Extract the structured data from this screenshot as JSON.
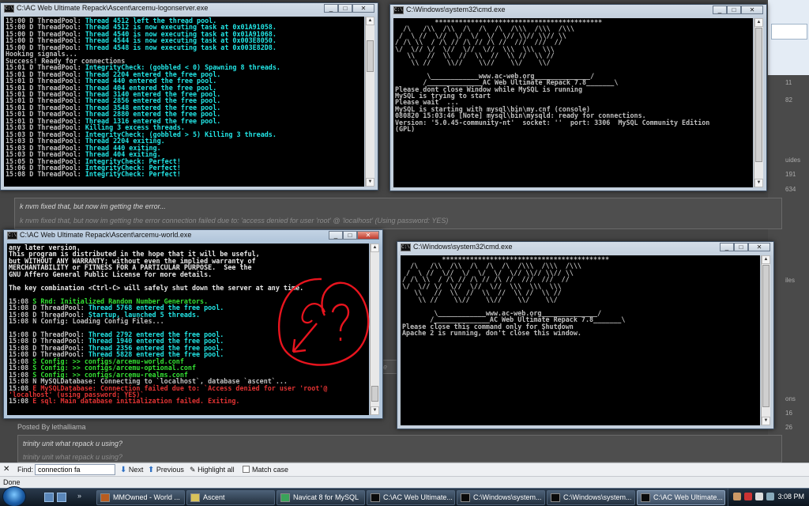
{
  "forum": {
    "right_numbers": [
      "11",
      "82",
      "uides",
      "191",
      "634",
      "iles",
      "ons",
      "16",
      "26"
    ],
    "post1_line1": "k nvm fixed that, but now im getting the error...",
    "post1_line2": "k nvm fixed that, but now im getting the error connection failed due to: 'access denied for user 'root' @ 'localhost' (Using password: YES)",
    "posted_by": "Posted By lethalliama",
    "post2_line1": "trinity unit what repack u using?",
    "post2_line2": "trinity unit what repack u using?",
    "fragment_e": "e"
  },
  "windows": {
    "logon": {
      "title": "C:\\AC Web Ultimate Repack\\Ascent\\arcemu-logonserver.exe",
      "lines": [
        [
          [
            "c-grey",
            "15:00 D ThreadPool: "
          ],
          [
            "c-cyan",
            "Thread 4512 left the thread pool."
          ]
        ],
        [
          [
            "c-grey",
            "15:00 D ThreadPool: "
          ],
          [
            "c-cyan",
            "Thread 4512 is now executing task at 0x01A91058."
          ]
        ],
        [
          [
            "c-grey",
            "15:00 D ThreadPool: "
          ],
          [
            "c-cyan",
            "Thread 4540 is now executing task at 0x01A91068."
          ]
        ],
        [
          [
            "c-grey",
            "15:00 D ThreadPool: "
          ],
          [
            "c-cyan",
            "Thread 4544 is now executing task at 0x003E8050."
          ]
        ],
        [
          [
            "c-grey",
            "15:00 D ThreadPool: "
          ],
          [
            "c-cyan",
            "Thread 4548 is now executing task at 0x003E82D8."
          ]
        ],
        [
          [
            "c-grey",
            "Hooking signals..."
          ]
        ],
        [
          [
            "c-grey",
            "Success! Ready for connections"
          ]
        ],
        [
          [
            "c-grey",
            "15:01 D ThreadPool: "
          ],
          [
            "c-cyan",
            "IntegrityCheck: (gobbled < 0) Spawning 8 threads."
          ]
        ],
        [
          [
            "c-grey",
            "15:01 D ThreadPool: "
          ],
          [
            "c-cyan",
            "Thread 2204 entered the free pool."
          ]
        ],
        [
          [
            "c-grey",
            "15:01 D ThreadPool: "
          ],
          [
            "c-cyan",
            "Thread 440 entered the free pool."
          ]
        ],
        [
          [
            "c-grey",
            "15:01 D ThreadPool: "
          ],
          [
            "c-cyan",
            "Thread 404 entered the free pool."
          ]
        ],
        [
          [
            "c-grey",
            "15:01 D ThreadPool: "
          ],
          [
            "c-cyan",
            "Thread 3140 entered the free pool."
          ]
        ],
        [
          [
            "c-grey",
            "15:01 D ThreadPool: "
          ],
          [
            "c-cyan",
            "Thread 2856 entered the free pool."
          ]
        ],
        [
          [
            "c-grey",
            "15:01 D ThreadPool: "
          ],
          [
            "c-cyan",
            "Thread 3548 entered the free pool."
          ]
        ],
        [
          [
            "c-grey",
            "15:01 D ThreadPool: "
          ],
          [
            "c-cyan",
            "Thread 2880 entered the free pool."
          ]
        ],
        [
          [
            "c-grey",
            "15:01 D ThreadPool: "
          ],
          [
            "c-cyan",
            "Thread 1316 entered the free pool."
          ]
        ],
        [
          [
            "c-grey",
            "15:03 D ThreadPool: "
          ],
          [
            "c-cyan",
            "Killing 3 excess threads."
          ]
        ],
        [
          [
            "c-grey",
            "15:03 D ThreadPool: "
          ],
          [
            "c-cyan",
            "IntegrityCheck: (gobbled > 5) Killing 3 threads."
          ]
        ],
        [
          [
            "c-grey",
            "15:03 D ThreadPool: "
          ],
          [
            "c-cyan",
            "Thread 2204 exiting."
          ]
        ],
        [
          [
            "c-grey",
            "15:03 D ThreadPool: "
          ],
          [
            "c-cyan",
            "Thread 440 exiting."
          ]
        ],
        [
          [
            "c-grey",
            "15:03 D ThreadPool: "
          ],
          [
            "c-cyan",
            "Thread 404 exiting."
          ]
        ],
        [
          [
            "c-grey",
            "15:05 D ThreadPool: "
          ],
          [
            "c-cyan",
            "IntegrityCheck: Perfect!"
          ]
        ],
        [
          [
            "c-grey",
            "15:06 D ThreadPool: "
          ],
          [
            "c-cyan",
            "IntegrityCheck: Perfect!"
          ]
        ],
        [
          [
            "c-grey",
            "15:08 D ThreadPool: "
          ],
          [
            "c-cyan",
            "IntegrityCheck: Perfect!"
          ]
        ]
      ]
    },
    "mysql": {
      "title": "C:\\Windows\\system32\\cmd.exe",
      "lines": [
        [
          [
            "c-grey",
            "          ******************************************"
          ]
        ],
        [
          [
            "c-grey",
            "  /\\   /\\\\  /\\\\  /\\  /\\  /\\  /\\\\\\  /\\\\\\  /\\\\\\"
          ]
        ],
        [
          [
            "c-grey",
            " /  \\ //  \\//  \\/  \\/  \\/  \\// \\\\// \\\\// \\\\"
          ]
        ],
        [
          [
            "c-grey",
            "/ /\\ \\\\  / /\\ // /\\ // /\\ //  ///  ///  //"
          ]
        ],
        [
          [
            "c-grey",
            "\\/  \\// \\/  \\//  \\//  \\//  \\\\\\  \\\\\\  \\\\\\"
          ]
        ],
        [
          [
            "c-grey",
            "   \\\\   //  \\\\  //  \\\\  //  \\\\ //  \\\\ //"
          ]
        ],
        [
          [
            "c-grey",
            "    \\\\ //    \\\\//    \\\\//    \\\\/    \\\\/"
          ]
        ],
        [
          [
            "c-grey",
            ""
          ]
        ],
        [
          [
            "c-grey",
            "        \\____________www.ac-web.org______________/"
          ]
        ],
        [
          [
            "c-grey",
            "       /______________AC Web Ultimate Repack 7.8_______\\"
          ]
        ],
        [
          [
            "c-grey",
            "Please dont close Window while MySQL is running"
          ]
        ],
        [
          [
            "c-grey",
            "MySQL is trying to start"
          ]
        ],
        [
          [
            "c-grey",
            "Please wait  ..."
          ]
        ],
        [
          [
            "c-grey",
            "MySQL is starting with mysql\\bin\\my.cnf (console)"
          ]
        ],
        [
          [
            "c-grey",
            "080820 15:03:46 [Note] mysql\\bin\\mysqld: ready for connections."
          ]
        ],
        [
          [
            "c-grey",
            "Version: '5.0.45-community-nt'  socket: ''  port: 3306  MySQL Community Edition"
          ]
        ],
        [
          [
            "c-grey",
            "(GPL)"
          ]
        ]
      ]
    },
    "world": {
      "title": "C:\\AC Web Ultimate Repack\\Ascent\\arcemu-world.exe",
      "lines": [
        [
          [
            "c-white",
            "any later version."
          ]
        ],
        [
          [
            "c-white",
            "This program is distributed in the hope that it will be useful,"
          ]
        ],
        [
          [
            "c-white",
            "but WITHOUT ANY WARRANTY; without even the implied warranty of"
          ]
        ],
        [
          [
            "c-white",
            "MERCHANTABILITY or FITNESS FOR A PARTICULAR PURPOSE.  See the"
          ]
        ],
        [
          [
            "c-white",
            "GNU Affero General Public License for more details."
          ]
        ],
        [
          [
            "c-white",
            ""
          ]
        ],
        [
          [
            "c-white",
            "The key combination <Ctrl-C> will safely shut down the server at any time."
          ]
        ],
        [
          [
            "c-white",
            ""
          ]
        ],
        [
          [
            "c-grey",
            "15:08 "
          ],
          [
            "c-green",
            "S Rnd: Initialized Random Number Generators."
          ]
        ],
        [
          [
            "c-grey",
            "15:08 D ThreadPool: "
          ],
          [
            "c-cyan",
            "Thread 5768 entered the free pool."
          ]
        ],
        [
          [
            "c-grey",
            "15:08 D ThreadPool: "
          ],
          [
            "c-cyan",
            "Startup, launched 5 threads."
          ]
        ],
        [
          [
            "c-grey",
            "15:08 N Config: Loading Config Files..."
          ]
        ],
        [
          [
            "c-grey",
            ""
          ]
        ],
        [
          [
            "c-grey",
            "15:08 D ThreadPool: "
          ],
          [
            "c-cyan",
            "Thread 2792 entered the free pool."
          ]
        ],
        [
          [
            "c-grey",
            "15:08 D ThreadPool: "
          ],
          [
            "c-cyan",
            "Thread 1940 entered the free pool."
          ]
        ],
        [
          [
            "c-grey",
            "15:08 D ThreadPool: "
          ],
          [
            "c-cyan",
            "Thread 2356 entered the free pool."
          ]
        ],
        [
          [
            "c-grey",
            "15:08 D ThreadPool: "
          ],
          [
            "c-cyan",
            "Thread 5828 entered the free pool."
          ]
        ],
        [
          [
            "c-grey",
            "15:08 "
          ],
          [
            "c-green",
            "S Config: >> configs/arcemu-world.conf"
          ]
        ],
        [
          [
            "c-grey",
            "15:08 "
          ],
          [
            "c-green",
            "S Config: >> configs/arcemu-optional.conf"
          ]
        ],
        [
          [
            "c-grey",
            "15:08 "
          ],
          [
            "c-green",
            "S Config: >> configs/arcemu-realms.conf"
          ]
        ],
        [
          [
            "c-grey",
            "15:08 N MySQLDatabase: Connecting to `localhost`, database `ascent`..."
          ]
        ],
        [
          [
            "c-grey",
            "15:08 "
          ],
          [
            "c-red",
            "E MySQLDatabase: Connection failed due to: `Access denied for user 'root'@"
          ]
        ],
        [
          [
            "c-red",
            "'localhost' (using password: YES)`"
          ]
        ],
        [
          [
            "c-grey",
            "15:08 "
          ],
          [
            "c-red",
            "E sql: Main database initialization failed. Exiting."
          ]
        ]
      ]
    },
    "apache": {
      "title": "C:\\Windows\\system32\\cmd.exe",
      "lines": [
        [
          [
            "c-grey",
            "          ******************************************"
          ]
        ],
        [
          [
            "c-grey",
            "  /\\   /\\\\  /\\\\  /\\  /\\  /\\  /\\\\\\  /\\\\\\  /\\\\\\"
          ]
        ],
        [
          [
            "c-grey",
            " /  \\ //  \\//  \\/  \\/  \\/  \\// \\\\// \\\\// \\\\"
          ]
        ],
        [
          [
            "c-grey",
            "/ /\\ \\\\  / /\\ // /\\ // /\\ //  ///  ///  //"
          ]
        ],
        [
          [
            "c-grey",
            "\\/  \\// \\/  \\//  \\//  \\//  \\\\\\  \\\\\\  \\\\\\"
          ]
        ],
        [
          [
            "c-grey",
            "   \\\\   //  \\\\  //  \\\\  //  \\\\ //  \\\\ //"
          ]
        ],
        [
          [
            "c-grey",
            "    \\\\ //    \\\\//    \\\\//    \\\\/    \\\\/"
          ]
        ],
        [
          [
            "c-grey",
            ""
          ]
        ],
        [
          [
            "c-grey",
            "        \\____________www.ac-web.org______________/"
          ]
        ],
        [
          [
            "c-grey",
            "       /______________AC Web Ultimate Repack 7.8_______\\"
          ]
        ],
        [
          [
            "c-grey",
            "Please close this command only for Shutdown"
          ]
        ],
        [
          [
            "c-grey",
            "Apache 2 is running, don't close this window."
          ]
        ]
      ]
    }
  },
  "find_bar": {
    "close_glyph": "✕",
    "label": "Find:",
    "value": "connection fa",
    "next_label": "Next",
    "previous_label": "Previous",
    "highlight_label": "Highlight all",
    "match_case_label": "Match case"
  },
  "status_bar": {
    "text": "Done"
  },
  "taskbar": {
    "buttons": [
      "MMOwned - World ...",
      "Ascent",
      "Navicat 8 for MySQL",
      "C:\\AC Web Ultimate...",
      "C:\\Windows\\system...",
      "C:\\Windows\\system...",
      "C:\\AC Web Ultimate..."
    ],
    "chevron": "»",
    "clock": "3:08 PM"
  },
  "colors": {
    "cyan": "#22e5e5",
    "green": "#33e033",
    "red": "#e23333",
    "annotation_red": "#e8141e"
  }
}
